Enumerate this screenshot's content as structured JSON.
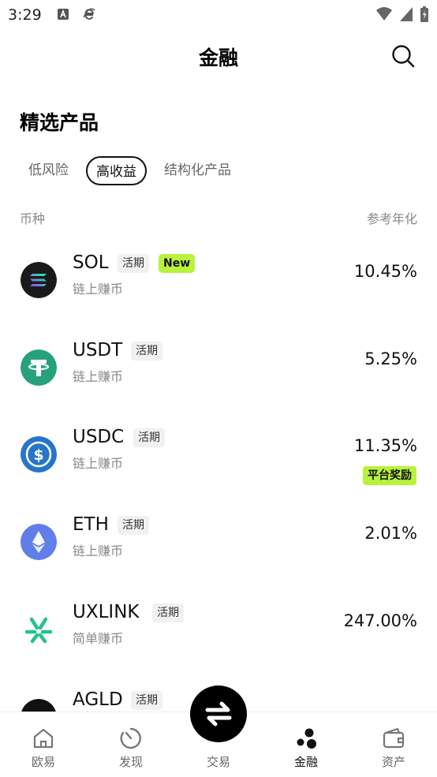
{
  "status_bar": {
    "time": "3:29"
  },
  "header": {
    "title": "金融"
  },
  "section": {
    "title": "精选产品"
  },
  "tabs": [
    {
      "label": "低风险",
      "active": false
    },
    {
      "label": "高收益",
      "active": true
    },
    {
      "label": "结构化产品",
      "active": false
    }
  ],
  "columns": {
    "left": "币种",
    "right": "参考年化"
  },
  "products": [
    {
      "name": "SOL",
      "tag": "活期",
      "badge": "New",
      "sub": "链上赚币",
      "rate": "10.45%",
      "reward": ""
    },
    {
      "name": "USDT",
      "tag": "活期",
      "badge": "",
      "sub": "链上赚币",
      "rate": "5.25%",
      "reward": ""
    },
    {
      "name": "USDC",
      "tag": "活期",
      "badge": "",
      "sub": "链上赚币",
      "rate": "11.35%",
      "reward": "平台奖励"
    },
    {
      "name": "ETH",
      "tag": "活期",
      "badge": "",
      "sub": "链上赚币",
      "rate": "2.01%",
      "reward": ""
    },
    {
      "name": "UXLINK",
      "tag": "活期",
      "badge": "",
      "sub": "简单赚币",
      "rate": "247.00%",
      "reward": ""
    },
    {
      "name": "AGLD",
      "tag": "活期",
      "badge": "",
      "sub": "",
      "rate": "",
      "reward": ""
    }
  ],
  "bottom_nav": [
    {
      "label": "欧易",
      "icon": "home-icon"
    },
    {
      "label": "发现",
      "icon": "discover-icon"
    },
    {
      "label": "交易",
      "icon": "trade-swap-icon"
    },
    {
      "label": "金融",
      "icon": "finance-icon",
      "active": true
    },
    {
      "label": "资产",
      "icon": "wallet-icon"
    }
  ],
  "colors": {
    "accent_green": "#b8f23c",
    "usdt": "#26a17b",
    "usdc": "#2775ca",
    "eth": "#627eea",
    "uxlink": "#25c28a"
  }
}
